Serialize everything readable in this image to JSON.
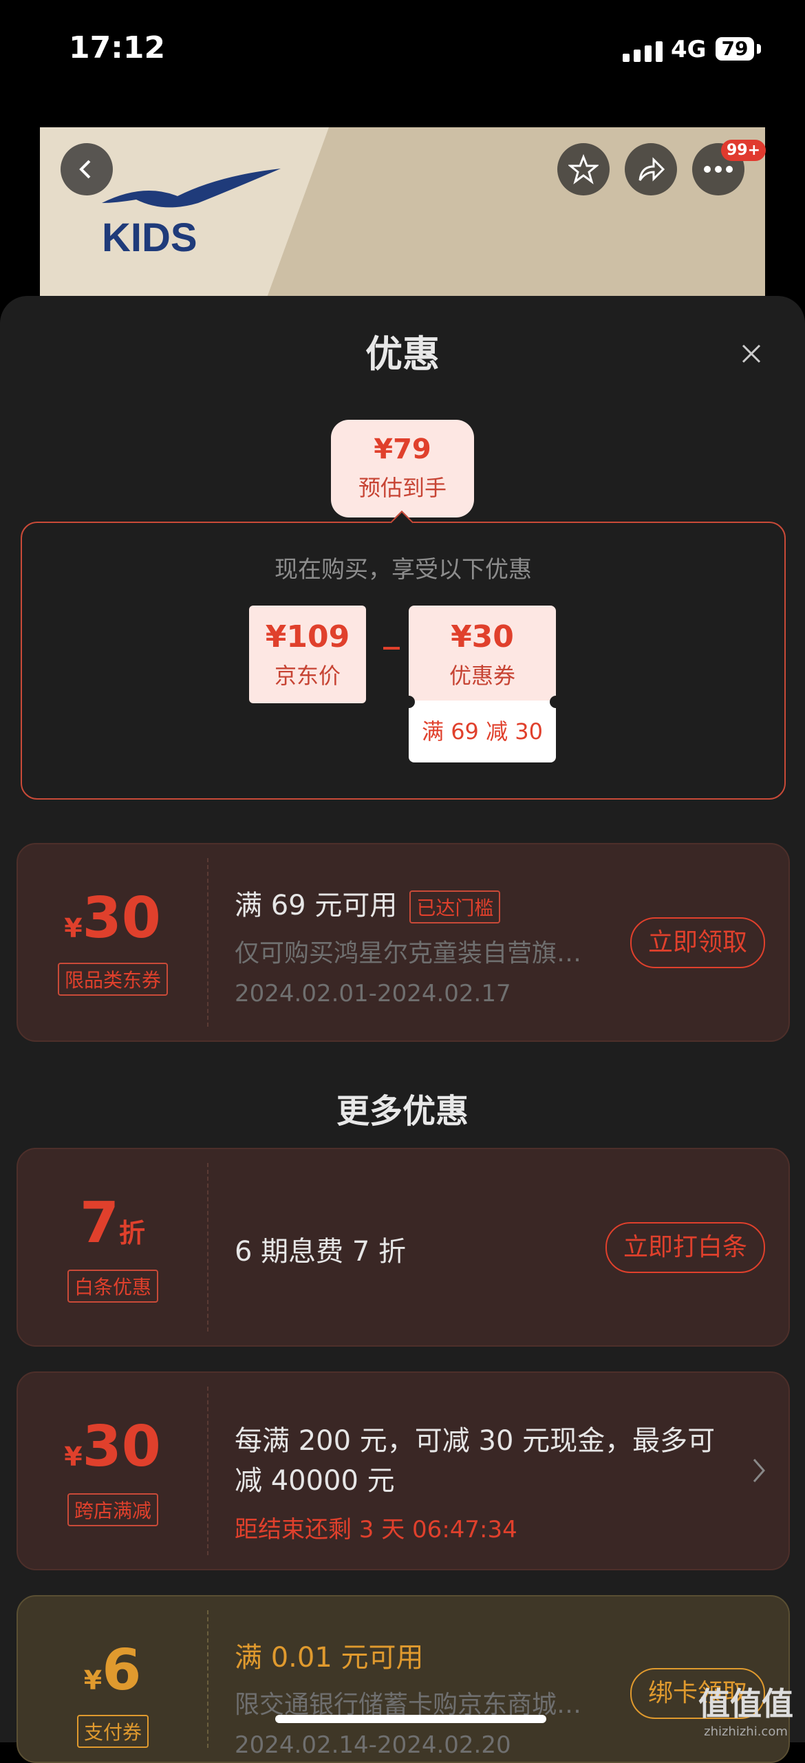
{
  "status": {
    "time": "17:12",
    "network": "4G",
    "battery": "79"
  },
  "hero": {
    "logo_text": "KIDS",
    "notification_badge": "99+"
  },
  "sheet": {
    "title": "优惠"
  },
  "estimate": {
    "price": "¥79",
    "label": "预估到手"
  },
  "summary": {
    "subtitle": "现在购买，享受以下优惠",
    "jd_price": "¥109",
    "jd_price_label": "京东价",
    "coupon_price": "¥30",
    "coupon_label": "优惠券",
    "coupon_condition": "满 69 减 30"
  },
  "coupon1": {
    "currency": "¥",
    "amount": "30",
    "tag": "限品类东券",
    "title": "满 69 元可用",
    "status": "已达门槛",
    "desc": "仅可购买鸿星尔克童装自营旗…",
    "date": "2024.02.01-2024.02.17",
    "action": "立即领取"
  },
  "more_title": "更多优惠",
  "offer_baitiao": {
    "amount": "7",
    "unit": "折",
    "tag": "白条优惠",
    "title": "6 期息费 7 折",
    "action": "立即打白条"
  },
  "offer_crossstore": {
    "currency": "¥",
    "amount": "30",
    "tag": "跨店满减",
    "title_line1": "每满 200 元，可减 30 元现金，最多可",
    "title_line2": "减 40000 元",
    "countdown": "距结束还剩 3 天 06:47:34"
  },
  "offer_payment": {
    "currency": "¥",
    "amount": "6",
    "tag": "支付券",
    "title": "满 0.01 元可用",
    "desc": "限交通银行储蓄卡购京东商城…",
    "date": "2024.02.14-2024.02.20",
    "action": "绑卡领取"
  },
  "watermark": {
    "text": "值值值",
    "domain": "zhizhizhi.com"
  },
  "colors": {
    "accent": "#e0402c",
    "sheet_bg": "#1e1e1e",
    "gold": "#e09a2e"
  }
}
